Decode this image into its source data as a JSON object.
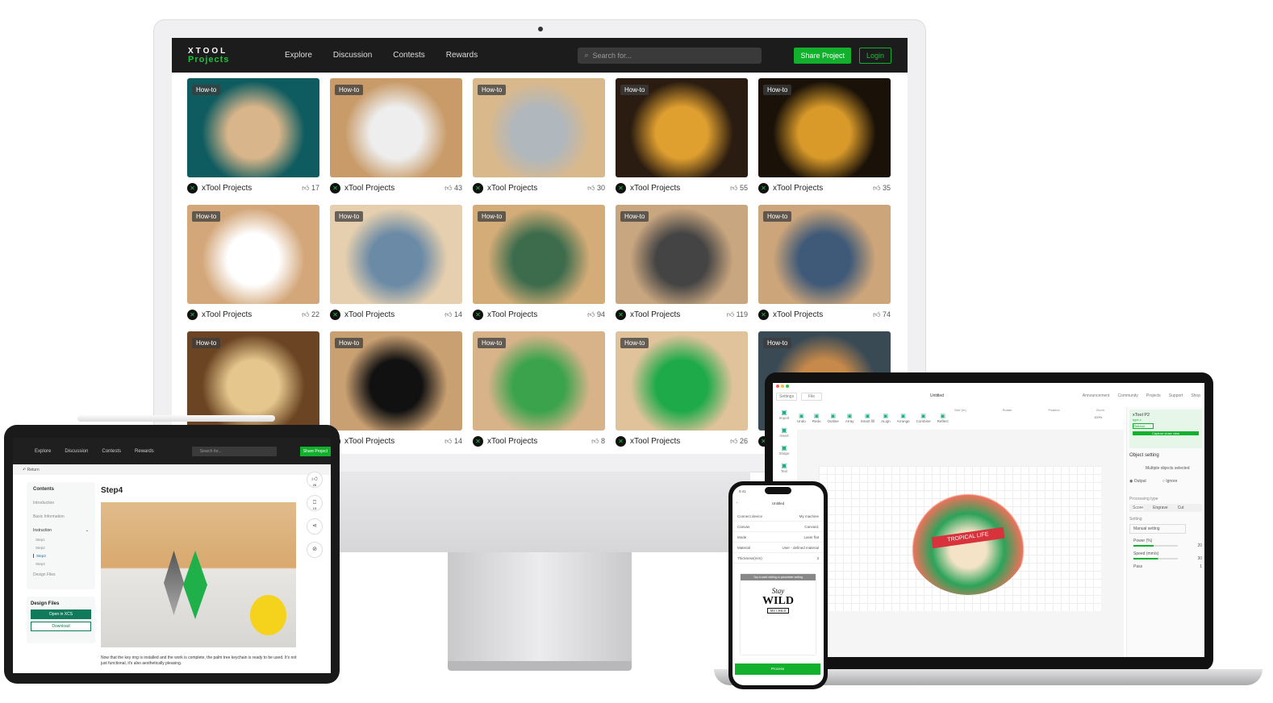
{
  "desktop": {
    "logo_top": "XTOOL",
    "logo_bottom": "Projects",
    "nav": [
      "Explore",
      "Discussion",
      "Contests",
      "Rewards"
    ],
    "search_placeholder": "Search for...",
    "share_button": "Share Project",
    "login_button": "Login",
    "badge": "How-to",
    "author": "xTool Projects",
    "cards": [
      {
        "likes": "17",
        "colors": [
          "#0f5c60",
          "#d8b58a"
        ]
      },
      {
        "likes": "43",
        "colors": [
          "#c89b68",
          "#eee"
        ]
      },
      {
        "likes": "30",
        "colors": [
          "#d9b98c",
          "#b0b7bd"
        ]
      },
      {
        "likes": "55",
        "colors": [
          "#2a1c10",
          "#e0a030"
        ]
      },
      {
        "likes": "35",
        "colors": [
          "#1a1208",
          "#d99a2a"
        ]
      },
      {
        "likes": "22",
        "colors": [
          "#d3a77a",
          "#fff"
        ]
      },
      {
        "likes": "14",
        "colors": [
          "#e5cfae",
          "#6a8aa6"
        ]
      },
      {
        "likes": "94",
        "colors": [
          "#d4ac78",
          "#3c6c4c"
        ]
      },
      {
        "likes": "119",
        "colors": [
          "#c8a67f",
          "#444"
        ]
      },
      {
        "likes": "74",
        "colors": [
          "#cda57a",
          "#3f5a78"
        ]
      },
      {
        "likes": "",
        "colors": [
          "#6b4423",
          "#e5c68c"
        ]
      },
      {
        "likes": "14",
        "colors": [
          "#c9a072",
          "#111"
        ]
      },
      {
        "likes": "8",
        "colors": [
          "#d8b38a",
          "#3aa34c"
        ]
      },
      {
        "likes": "26",
        "colors": [
          "#e0c39a",
          "#1faa4a"
        ]
      },
      {
        "likes": "",
        "colors": [
          "#3a4a55",
          "#c88a4a"
        ]
      }
    ]
  },
  "tablet": {
    "nav": [
      "Explore",
      "Discussion",
      "Contests",
      "Rewards"
    ],
    "search_placeholder": "Search for...",
    "share_button": "Share Project",
    "return": "Return",
    "toc_title": "Contents",
    "toc": [
      "Introduction",
      "Basic Information",
      "Instruction"
    ],
    "steps": [
      "Step1",
      "Step2",
      "Step3",
      "Step4"
    ],
    "design_files_link": "Design Files",
    "design_files_title": "Design Files",
    "open_xcs": "Open in XCS",
    "download": "Download",
    "step_title": "Step4",
    "likes": "26",
    "saves": "13",
    "description": "Now that the key ring is installed and the work is complete, the palm tree keychain is ready to be used. It's not just functional, it's also aesthetically pleasing."
  },
  "laptop": {
    "tabs": [
      "Settings",
      "File"
    ],
    "title": "Untitled",
    "links": [
      "Announcement",
      "Community",
      "Projects",
      "Support",
      "Shop"
    ],
    "tools": [
      "Undo",
      "Redo",
      "Outline",
      "Array",
      "Smart fill",
      "ALign",
      "Arrange",
      "Combine",
      "Reflect"
    ],
    "left_tools": [
      "Import",
      "Insert",
      "Shape",
      "Text"
    ],
    "size_label": "Size (in)",
    "rotate_label": "Rotate",
    "position_label": "Position",
    "zoom_label": "Zoom",
    "zoom_value": "100%",
    "device": "xTool P2",
    "connection": "type-c",
    "refresh": "Refresh",
    "capture": "Capture close view",
    "object_setting": "Object setting",
    "multiple": "Multiple objects selected",
    "output": "Output",
    "ignore": "Ignore",
    "processing_type": "Processing type",
    "proc_tabs": [
      "Score",
      "Engrave",
      "Cut"
    ],
    "setting": "Setting",
    "manual": "Manual setting",
    "power_label": "Power (%)",
    "power": "20",
    "speed_label": "Speed (mm/s)",
    "speed": "30",
    "pass_label": "Pass",
    "pass": "1",
    "artwork_text": "TROPICAL LIFE",
    "accent": "#12b02c"
  },
  "phone": {
    "time": "9:41",
    "title": "Untitled",
    "rows": [
      {
        "k": "Connect device",
        "v": "My machine"
      },
      {
        "k": "Canvas",
        "v": "Canvas1"
      },
      {
        "k": "Mode",
        "v": "Laser flat"
      },
      {
        "k": "Material",
        "v": "User - defined material"
      },
      {
        "k": "Thickness(mm)",
        "v": "3"
      }
    ],
    "hint": "Tap to start editing or parameter setting",
    "art_line1": "Stay",
    "art_line2": "WILD",
    "art_line3": "MY CHILD",
    "process": "Process"
  }
}
